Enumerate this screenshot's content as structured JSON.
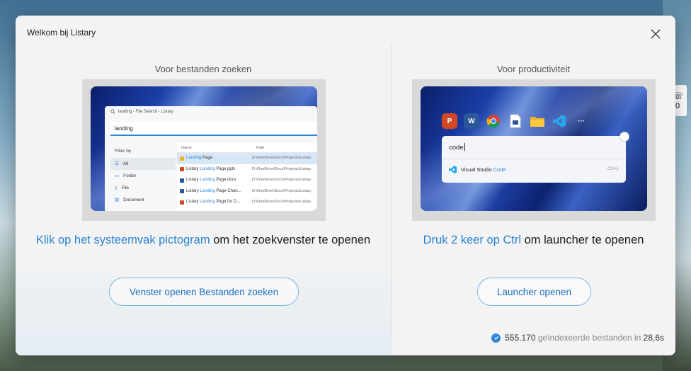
{
  "desktop": {
    "tray_digit": "0"
  },
  "dialog": {
    "title": "Welkom bij Listary"
  },
  "left": {
    "section_title": "Voor bestanden zoeken",
    "preview": {
      "window_title": "landing - File Search - Listary",
      "query": "landing",
      "filter_title": "Filter by",
      "filters": [
        "All",
        "Folder",
        "File",
        "Document"
      ],
      "columns": [
        "Name",
        "Path"
      ],
      "rows": [
        {
          "prefix": "",
          "match": "Landing",
          "suffix": " Page",
          "path": "D:\\OneDrive\\Docs\\Projects\\Listary",
          "icon_color": "#f0b429"
        },
        {
          "prefix": "Listary ",
          "match": "Landing",
          "suffix": " Page.pptx",
          "path": "D:\\OneDrive\\Docs\\Projects\\Listary",
          "icon_color": "#d24726"
        },
        {
          "prefix": "Listary ",
          "match": "Landing",
          "suffix": " Page.docx",
          "path": "D:\\OneDrive\\Docs\\Projects\\Listary",
          "icon_color": "#2b579a"
        },
        {
          "prefix": "Listary ",
          "match": "Landing",
          "suffix": " Page-Chan...",
          "path": "D:\\OneDrive\\Docs\\Projects\\Listary",
          "icon_color": "#2b579a"
        },
        {
          "prefix": "Listary ",
          "match": "Landing",
          "suffix": " Page for D...",
          "path": "D:\\OneDrive\\Docs\\Projects\\Listary",
          "icon_color": "#d24726"
        }
      ]
    },
    "instruction_link": "Klik op het systeemvak pictogram",
    "instruction_rest": " om het zoekvenster te openen",
    "button_label": "Venster openen Bestanden zoeken"
  },
  "right": {
    "section_title": "Voor productiviteit",
    "preview": {
      "app_icons": [
        {
          "name": "powerpoint",
          "glyph": "P",
          "color": "#d24726"
        },
        {
          "name": "word",
          "glyph": "W",
          "color": "#2b579a"
        },
        {
          "name": "chrome",
          "glyph": "",
          "color": "#ffffff"
        },
        {
          "name": "document",
          "glyph": "",
          "color": "#ffffff"
        },
        {
          "name": "folder",
          "glyph": "",
          "color": "#f0b429"
        },
        {
          "name": "vscode",
          "glyph": "",
          "color": "#23a9f2"
        }
      ],
      "more": "···",
      "query": "code",
      "result_prefix": "Visual Studio ",
      "result_match": "Code",
      "result_shortcut": "Ctrl+1"
    },
    "instruction_link": "Druk 2 keer op Ctrl",
    "instruction_rest": " om launcher te openen",
    "button_label": "Launcher openen"
  },
  "status": {
    "count": "555.170",
    "label": " geïndexeerde bestanden in ",
    "time": "28,6s"
  },
  "colors": {
    "accent": "#2a83d4",
    "button_border": "#7fb5e4"
  }
}
